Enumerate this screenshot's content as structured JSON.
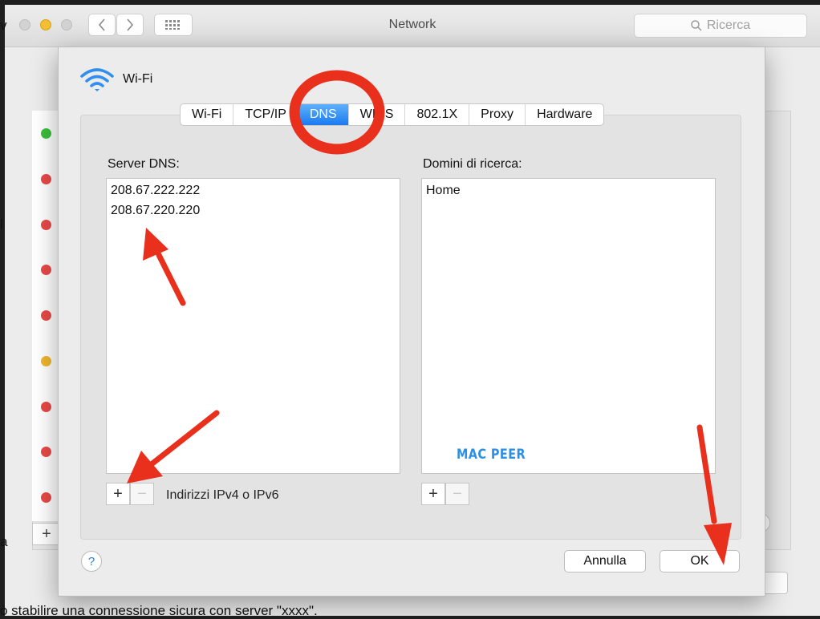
{
  "window": {
    "title": "Network"
  },
  "search": {
    "placeholder": "Ricerca"
  },
  "edge_text": {
    "top": "v",
    "mid1": "l",
    "mid2": "a",
    "bottom": "ò stabilire una connessione sicura con server \"xxxx\"."
  },
  "sheet": {
    "interface_name": "Wi-Fi",
    "tabs": [
      {
        "label": "Wi-Fi"
      },
      {
        "label": "TCP/IP"
      },
      {
        "label": "DNS"
      },
      {
        "label": "WINS"
      },
      {
        "label": "802.1X"
      },
      {
        "label": "Proxy"
      },
      {
        "label": "Hardware"
      }
    ],
    "dns": {
      "label": "Server DNS:",
      "servers": [
        "208.67.222.222",
        "208.67.220.220"
      ],
      "hint": "Indirizzi IPv4 o IPv6"
    },
    "search_domains": {
      "label": "Domini di ricerca:",
      "items": [
        "Home"
      ]
    },
    "add_symbol": "+",
    "remove_symbol": "−",
    "help_symbol": "?",
    "cancel_label": "Annulla",
    "ok_label": "OK"
  },
  "watermark": "MAC PEER",
  "icons": {
    "wifi": "wifi-icon",
    "back": "chevron-left-icon",
    "forward": "chevron-right-icon",
    "grid": "grid-icon",
    "search": "search-icon"
  },
  "colors": {
    "accent": "#1a7bf0",
    "annotation_red": "#e8301c",
    "watermark": "#2c8fe6",
    "status_green": "#3dbf3a",
    "status_red": "#e84a48",
    "status_yellow": "#f0b62e"
  }
}
